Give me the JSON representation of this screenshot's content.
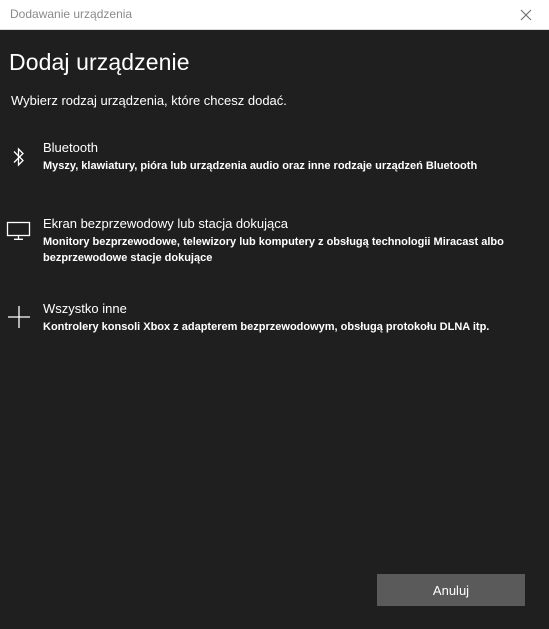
{
  "window": {
    "title": "Dodawanie urządzenia",
    "close_icon": "close-icon"
  },
  "main": {
    "heading": "Dodaj urządzenie",
    "subheading": "Wybierz rodzaj urządzenia, które chcesz dodać."
  },
  "options": [
    {
      "icon": "bluetooth-icon",
      "title": "Bluetooth",
      "description": "Myszy, klawiatury, pióra lub urządzenia audio oraz inne rodzaje urządzeń Bluetooth"
    },
    {
      "icon": "monitor-icon",
      "title": "Ekran bezprzewodowy lub stacja dokująca",
      "description": "Monitory bezprzewodowe, telewizory lub komputery z obsługą technologii Miracast albo bezprzewodowe stacje dokujące"
    },
    {
      "icon": "plus-icon",
      "title": "Wszystko inne",
      "description": "Kontrolery konsoli Xbox z adapterem bezprzewodowym, obsługą protokołu DLNA itp."
    }
  ],
  "footer": {
    "cancel_label": "Anuluj"
  },
  "colors": {
    "background": "#1f1f1f",
    "titlebar": "#ffffff",
    "button": "#5a5a5a",
    "text": "#ffffff"
  }
}
